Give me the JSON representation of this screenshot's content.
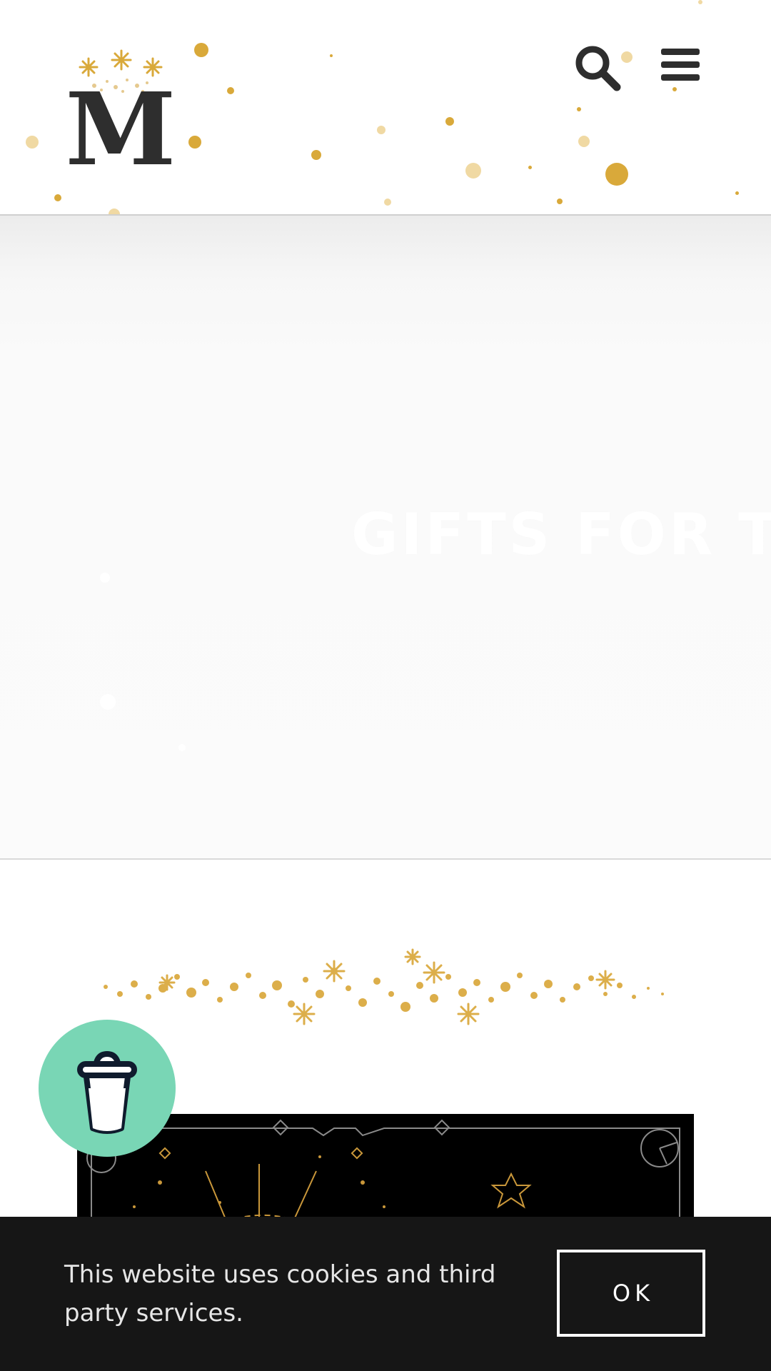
{
  "header": {
    "logo_letter": "M",
    "search_icon": "search-icon",
    "menu_icon": "hamburger-menu-icon"
  },
  "hero": {
    "title": "GIFTS FOR TH"
  },
  "cookie_banner": {
    "message": "This website uses cookies and third party services.",
    "ok_label": "OK"
  },
  "floating": {
    "coffee_icon": "coffee-cup-icon"
  },
  "colors": {
    "gold": "#d9a93a",
    "coffee_bg": "#79d6b5",
    "cookie_bg": "#161616",
    "logo": "#2e2e2e"
  }
}
